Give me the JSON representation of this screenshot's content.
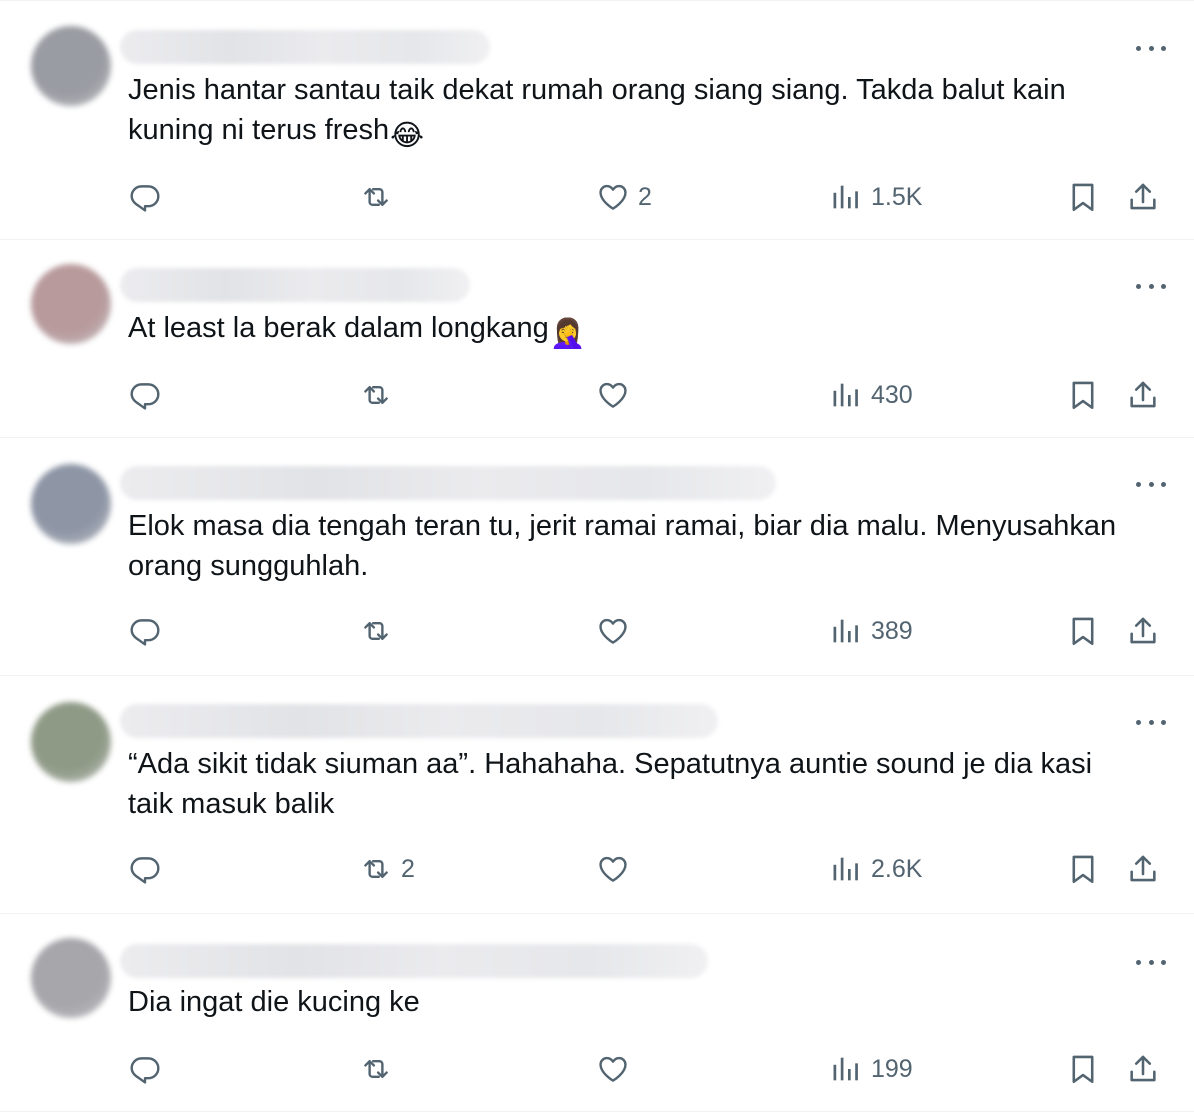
{
  "tweets": [
    {
      "text": "Jenis hantar santau taik dekat rumah orang siang siang. Takda balut kain kuning ni terus fresh",
      "emoji": "😂",
      "emoji_icon": "tears-of-joy-emoji-icon",
      "replies": "",
      "reposts": "",
      "likes": "2",
      "views": "1.5K",
      "avatar_color": "#9a9ca3"
    },
    {
      "text": "At least la berak dalam longkang",
      "emoji": "🤦‍♀️",
      "emoji_icon": "face-palm-emoji-icon",
      "replies": "",
      "reposts": "",
      "likes": "",
      "views": "430",
      "avatar_color": "#b89a9c"
    },
    {
      "text": "Elok masa dia tengah teran tu, jerit ramai ramai, biar dia malu. Menyusahkan orang sungguhlah.",
      "emoji": "",
      "emoji_icon": "",
      "replies": "",
      "reposts": "",
      "likes": "",
      "views": "389",
      "avatar_color": "#8e96a6"
    },
    {
      "text": "“Ada sikit tidak siuman aa”. Hahahaha. Sepatutnya auntie sound je dia kasi taik masuk balik",
      "emoji": "",
      "emoji_icon": "",
      "replies": "",
      "reposts": "2",
      "likes": "",
      "views": "2.6K",
      "avatar_color": "#8f9a86"
    },
    {
      "text": "Dia ingat die kucing ke",
      "emoji": "",
      "emoji_icon": "",
      "replies": "",
      "reposts": "",
      "likes": "",
      "views": "199",
      "avatar_color": "#a7a6ab"
    }
  ],
  "colors": {
    "icon": "#536471",
    "text": "#0f1419",
    "divider": "#eff3f4"
  }
}
